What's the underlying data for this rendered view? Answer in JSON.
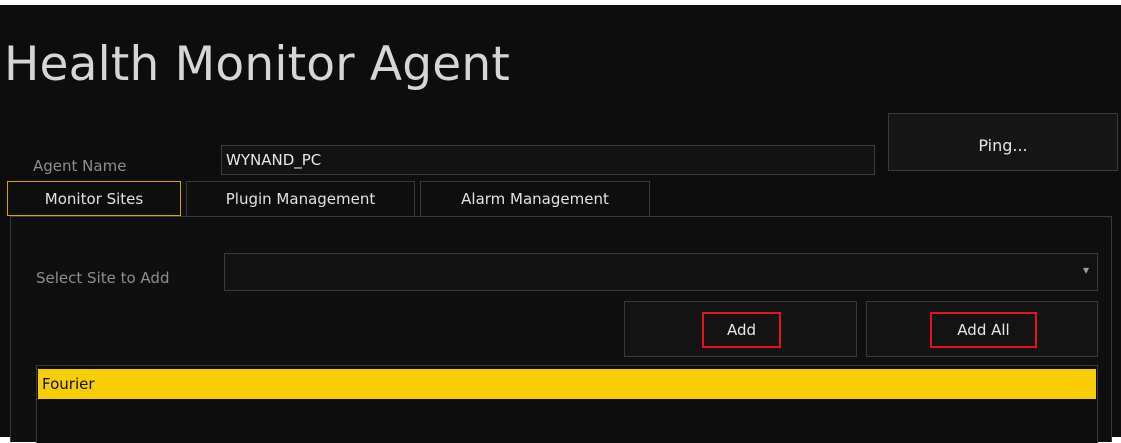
{
  "app": {
    "title": "Health Monitor Agent"
  },
  "agent": {
    "label": "Agent Name",
    "value": "WYNAND_PC",
    "ping_label": "Ping..."
  },
  "tabs": [
    {
      "label": "Monitor Sites",
      "active": true
    },
    {
      "label": "Plugin Management",
      "active": false
    },
    {
      "label": "Alarm Management",
      "active": false
    }
  ],
  "monitor_sites": {
    "select_label": "Select Site to Add",
    "selected_value": "",
    "add_label": "Add",
    "add_all_label": "Add All",
    "sites": [
      "Fourier"
    ]
  },
  "colors": {
    "background": "#0d0d0d",
    "active_tab_border": "#d9a400",
    "highlight_border": "#e0141e",
    "selected_row": "#f7cd04"
  },
  "icons": {
    "dropdown": "chevron-down-icon"
  }
}
